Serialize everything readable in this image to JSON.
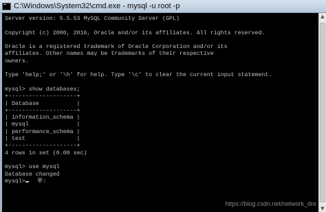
{
  "window": {
    "title": "C:\\Windows\\System32\\cmd.exe - mysql  -u root -p",
    "icon": "terminal-icon"
  },
  "console": {
    "lines": [
      "Server version: 5.5.53 MySQL Community Server (GPL)",
      "",
      "Copyright (c) 2000, 2016, Oracle and/or its affiliates. All rights reserved.",
      "",
      "Oracle is a registered trademark of Oracle Corporation and/or its",
      "affiliates. Other names may be trademarks of their respective",
      "owners.",
      "",
      "Type 'help;' or '\\h' for help. Type '\\c' to clear the current input statement.",
      "",
      "mysql> show databases;",
      "+--------------------+",
      "| Database           |",
      "+--------------------+",
      "| information_schema |",
      "| mysql              |",
      "| performance_schema |",
      "| test               |",
      "+--------------------+",
      "4 rows in set (0.00 sec)",
      "",
      "mysql> use mysql",
      "Database changed"
    ],
    "prompt": "mysql>",
    "ime_indicator": "半:"
  },
  "watermark": "https://blog.csdn.net/network_dre"
}
